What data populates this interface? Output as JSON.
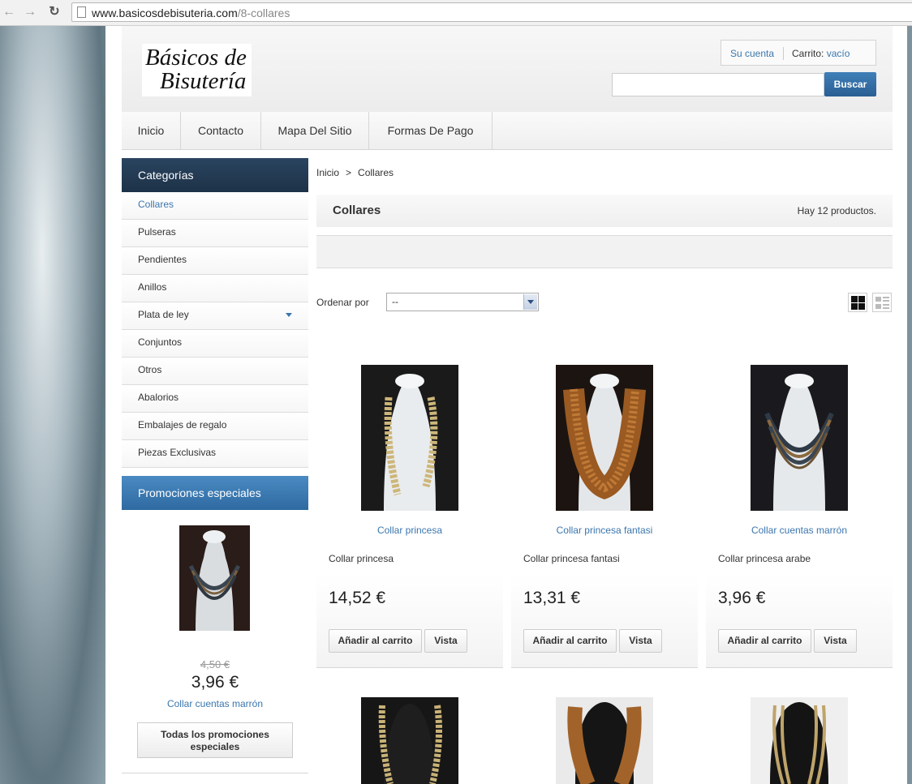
{
  "browser": {
    "url_domain": "www.basicosdebisuteria.com",
    "url_path": "/8-collares"
  },
  "header": {
    "logo_line1": "Básicos de",
    "logo_line2": "Bisutería",
    "account_label": "Su cuenta",
    "cart_label": "Carrito:",
    "cart_value": "vacío",
    "search_placeholder": "",
    "search_button": "Buscar"
  },
  "menu": [
    "Inicio",
    "Contacto",
    "Mapa Del Sitio",
    "Formas De Pago"
  ],
  "sidebar": {
    "categories_title": "Categorías",
    "categories": [
      "Collares",
      "Pulseras",
      "Pendientes",
      "Anillos",
      "Plata de ley",
      "Conjuntos",
      "Otros",
      "Abalorios",
      "Embalajes de regalo",
      "Piezas Exclusivas"
    ],
    "promo_title": "Promociones especiales",
    "promo_old_price": "4,50 €",
    "promo_price": "3,96 €",
    "promo_name": "Collar cuentas marrón",
    "promo_button": "Todas los promociones especiales"
  },
  "breadcrumb": {
    "home": "Inicio",
    "separator": ">",
    "current": "Collares"
  },
  "category": {
    "title": "Collares",
    "count_text": "Hay 12 productos."
  },
  "sort": {
    "label": "Ordenar por",
    "value": "--"
  },
  "products": [
    {
      "link": "Collar princesa",
      "desc": "Collar princesa",
      "price": "14,52 €",
      "add": "Añadir al carrito",
      "view": "Vista"
    },
    {
      "link": "Collar princesa fantasi",
      "desc": "Collar princesa fantasi",
      "price": "13,31 €",
      "add": "Añadir al carrito",
      "view": "Vista"
    },
    {
      "link": "Collar cuentas marrón",
      "desc": "Collar princesa arabe",
      "price": "3,96 €",
      "add": "Añadir al carrito",
      "view": "Vista"
    }
  ],
  "colors": {
    "accent": "#3b76ad",
    "cat_header": "#1d3247",
    "promo_header": "#2f6aa1"
  }
}
